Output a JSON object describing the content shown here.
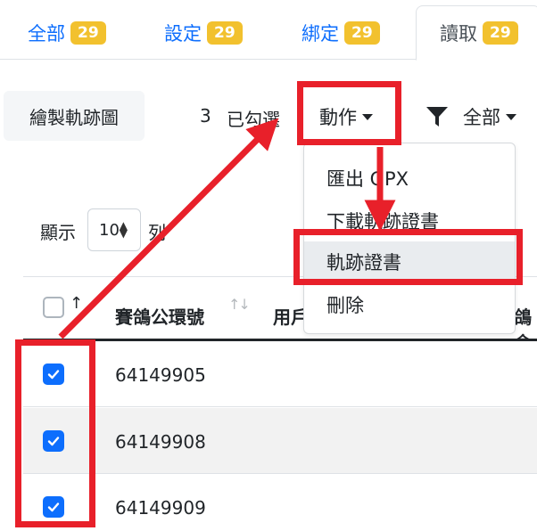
{
  "tabs": [
    {
      "label": "全部",
      "count": "29"
    },
    {
      "label": "設定",
      "count": "29"
    },
    {
      "label": "綁定",
      "count": "29"
    },
    {
      "label": "讀取",
      "count": "29"
    }
  ],
  "toolbar": {
    "draw_button": "繪製軌跡圖",
    "selected_count": "3",
    "selected_label": "已勾選",
    "action_label": "動作",
    "filter_label": "全部"
  },
  "action_menu": {
    "items": [
      "匯出 GPX",
      "下載軌跡證書",
      "軌跡證書",
      "刪除"
    ]
  },
  "length_control": {
    "show_label": "顯示",
    "value": "10",
    "rows_label": "列"
  },
  "table": {
    "sort_indicator": "↑",
    "sort_both": "↑↓",
    "columns": [
      "賽鴿公環號",
      "用戶",
      "鴿舍"
    ],
    "rows": [
      {
        "ring": "64149905",
        "checked": true
      },
      {
        "ring": "64149908",
        "checked": true
      },
      {
        "ring": "64149909",
        "checked": true
      }
    ]
  },
  "colors": {
    "link_blue": "#0d6efd",
    "badge_yellow": "#f2c12e",
    "annotation_red": "#e8202a",
    "checkbox_blue": "#0d6efd"
  }
}
